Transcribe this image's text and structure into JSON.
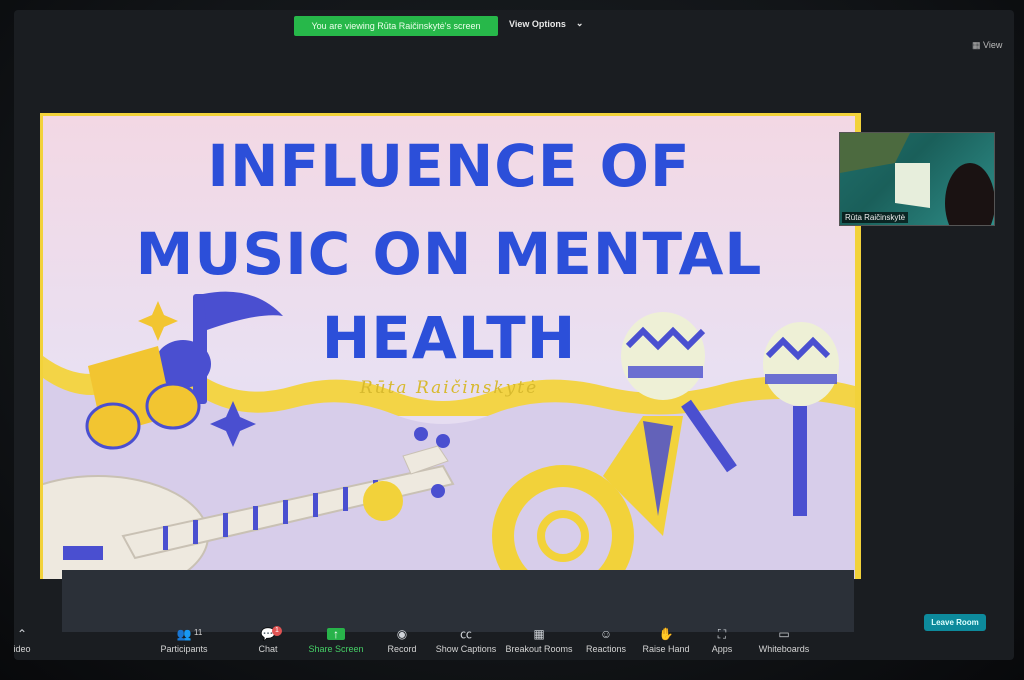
{
  "top_bar": {
    "viewing_text": "You are viewing Rūta Raičinskytė's screen",
    "view_options_label": "View Options",
    "view_label": "View"
  },
  "slide": {
    "title_line1": "INFLUENCE OF",
    "title_line2": "MUSIC ON MENTAL",
    "title_line3": "HEALTH",
    "author": "Rūta Raičinskytė",
    "colors": {
      "title": "#2c4fd9",
      "accent": "#f2d23a",
      "purple": "#4a4fd0"
    }
  },
  "participant": {
    "name": "Rūta Raičinskytė"
  },
  "toolbar": {
    "video_label": "ideo",
    "participants_label": "Participants",
    "participants_count": "11",
    "chat_label": "Chat",
    "chat_badge": "1",
    "share_label": "Share Screen",
    "record_label": "Record",
    "captions_label": "Show Captions",
    "breakout_label": "Breakout Rooms",
    "reactions_label": "Reactions",
    "raise_hand_label": "Raise Hand",
    "apps_label": "Apps",
    "whiteboards_label": "Whiteboards",
    "leave_label": "Leave Room"
  }
}
